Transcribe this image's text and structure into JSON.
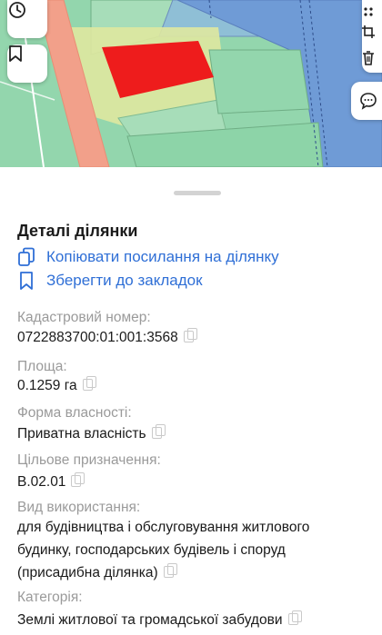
{
  "panel": {
    "title": "Деталі ділянки",
    "actions": [
      {
        "label": "Копіювати посилання на ділянку",
        "icon": "copy-link-icon"
      },
      {
        "label": "Зберегти до закладок",
        "icon": "bookmark-icon"
      }
    ]
  },
  "fields": [
    {
      "label": "Кадастровий номер:",
      "value": "0722883700:01:001:3568"
    },
    {
      "label": "Площа:",
      "value": "0.1259 га"
    },
    {
      "label": "Форма власності:",
      "value": "Приватна власність"
    },
    {
      "label": "Цільове призначення:",
      "value": "В.02.01"
    },
    {
      "label": "Вид використання:",
      "value_lines": [
        "для будівництва і обслуговування житлового",
        "будинку, господарських будівель і споруд",
        "(присадибна ділянка)"
      ]
    },
    {
      "label": "Категорія:",
      "value": "Землі житлової та громадської забудови"
    }
  ],
  "map": {
    "buttons": [
      "history-icon",
      "bookmark-icon"
    ],
    "toolbar": [
      "more-icon",
      "crop-icon",
      "trash-icon"
    ],
    "chat": "chat-icon",
    "colors": {
      "parcel_selected": "#ee1c1c",
      "parcel_green": "#8dd4a8",
      "parcel_blue": "#6f9bd6",
      "road": "#f2a08a",
      "yellow": "#e8eb9c"
    }
  }
}
